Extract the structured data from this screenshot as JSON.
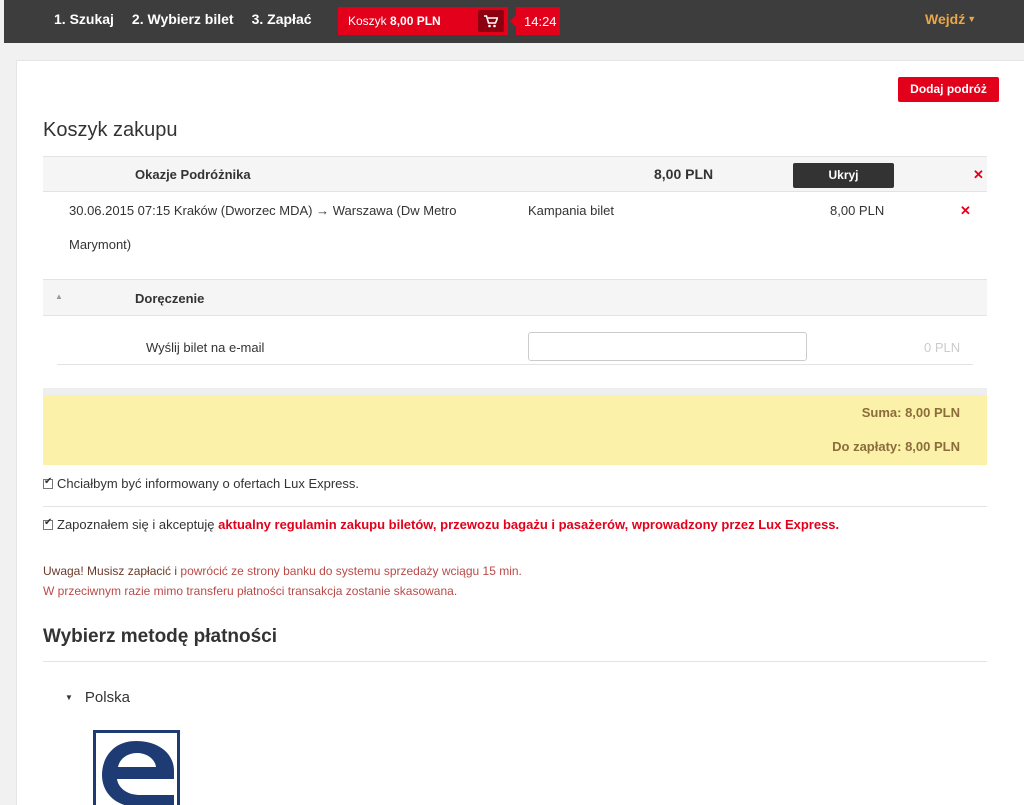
{
  "nav": {
    "steps": [
      "1. Szukaj",
      "2. Wybierz bilet",
      "3. Zapłać"
    ],
    "cart_label": "Koszyk",
    "cart_amount": "8,00 PLN",
    "timer": "14:24",
    "login": "Wejdź"
  },
  "cart": {
    "add_trip": "Dodaj podróż",
    "title": "Koszyk zakupu",
    "group": {
      "name": "Okazje Podróżnika",
      "price": "8,00 PLN",
      "hide_label": "Ukryj"
    },
    "trip": {
      "route": "30.06.2015 07:15 Kraków (Dworzec MDA) → Warszawa (Dw Metro Marymont)",
      "type": "Kampania bilet",
      "price": "8,00 PLN"
    },
    "delivery": {
      "title": "Doręczenie",
      "email_label": "Wyślij bilet na e-mail",
      "email_value": "",
      "email_price": "0 PLN"
    },
    "sum": "Suma: 8,00 PLN",
    "to_pay": "Do zapłaty: 8,00 PLN"
  },
  "consents": {
    "newsletter": "Chciałbym być informowany o ofertach Lux Express.",
    "terms_prefix": "Zapoznałem się i akceptuję",
    "terms_link": "aktualny regulamin zakupu biletów, przewozu bagażu i pasażerów, wprowadzony przez Lux Express."
  },
  "warning": {
    "line1_a": "Uwaga! Musisz zapłacić i ",
    "line1_b": "powrócić ze strony banku do systemu sprzedaży wciągu 15 min.",
    "line2": "W przeciwnym razie mimo transferu płatności transakcja zostanie skasowana."
  },
  "payment": {
    "title": "Wybierz metodę płatności",
    "country": "Polska"
  },
  "colors": {
    "accent": "#e3001b",
    "nav_bg": "#3d3d3d",
    "summary_bg": "#fcf1a8",
    "login": "#e8a849"
  }
}
